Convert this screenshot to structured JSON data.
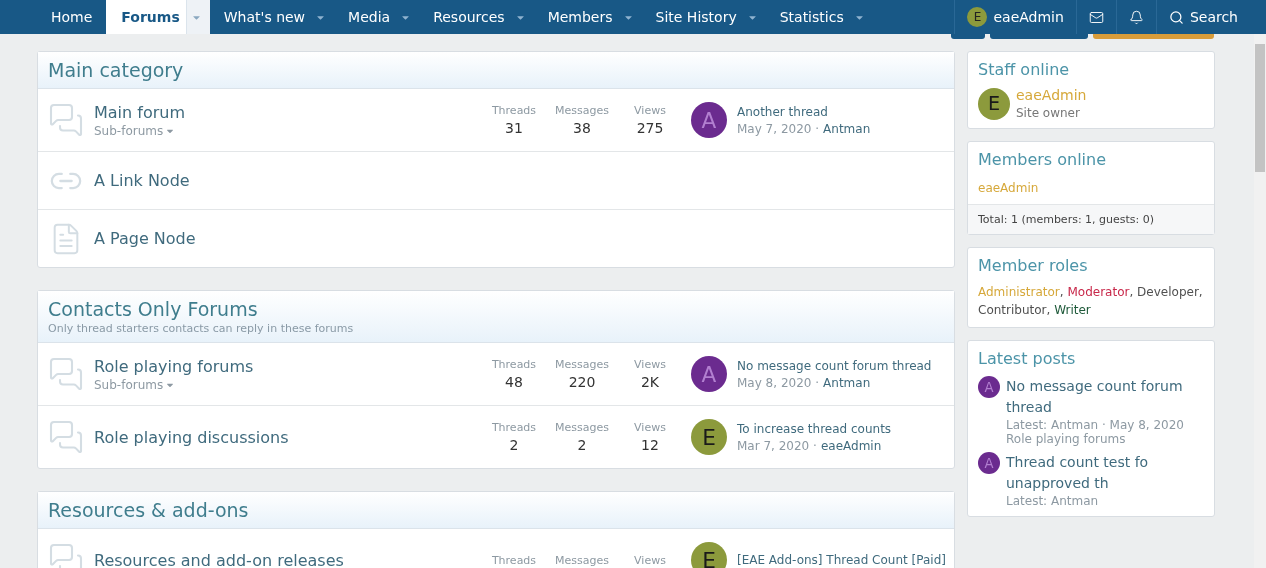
{
  "nav": {
    "tabs": [
      {
        "label": "Home",
        "selected": false,
        "dropdown": false
      },
      {
        "label": "Forums",
        "selected": true,
        "dropdown": true
      },
      {
        "label": "What's new",
        "selected": false,
        "dropdown": true
      },
      {
        "label": "Media",
        "selected": false,
        "dropdown": true
      },
      {
        "label": "Resources",
        "selected": false,
        "dropdown": true
      },
      {
        "label": "Members",
        "selected": false,
        "dropdown": true
      },
      {
        "label": "Site History",
        "selected": false,
        "dropdown": true
      },
      {
        "label": "Statistics",
        "selected": false,
        "dropdown": true
      }
    ],
    "user": {
      "letter": "E",
      "name": "eaeAdmin"
    },
    "search": "Search"
  },
  "categories": [
    {
      "title": "Main category",
      "nodes": [
        {
          "kind": "forum",
          "title": "Main forum",
          "subforums": "Sub-forums",
          "stats": [
            {
              "label": "Threads",
              "value": "31"
            },
            {
              "label": "Messages",
              "value": "38"
            },
            {
              "label": "Views",
              "value": "275"
            }
          ],
          "last": {
            "letter": "A",
            "color": "#6b2b8f",
            "title": "Another thread",
            "date": "May 7, 2020 ·",
            "user": "Antman"
          }
        },
        {
          "kind": "link",
          "title": "A Link Node"
        },
        {
          "kind": "page",
          "title": "A Page Node"
        }
      ]
    },
    {
      "title": "Contacts Only Forums",
      "description": "Only thread starters contacts can reply in these forums",
      "nodes": [
        {
          "kind": "forum",
          "title": "Role playing forums",
          "subforums": "Sub-forums",
          "stats": [
            {
              "label": "Threads",
              "value": "48"
            },
            {
              "label": "Messages",
              "value": "220"
            },
            {
              "label": "Views",
              "value": "2K"
            }
          ],
          "last": {
            "letter": "A",
            "color": "#6b2b8f",
            "title": "No message count forum thread",
            "date": "May 8, 2020 ·",
            "user": "Antman"
          }
        },
        {
          "kind": "forum",
          "title": "Role playing discussions",
          "stats": [
            {
              "label": "Threads",
              "value": "2"
            },
            {
              "label": "Messages",
              "value": "2"
            },
            {
              "label": "Views",
              "value": "12"
            }
          ],
          "last": {
            "letter": "E",
            "color": "#8c9a3c",
            "title": "To increase thread counts",
            "date": "Mar 7, 2020 ·",
            "user": "eaeAdmin"
          }
        }
      ]
    },
    {
      "title": "Resources & add-ons",
      "nodes": [
        {
          "kind": "forum",
          "title": "Resources and add-on releases",
          "stats": [
            {
              "label": "Threads"
            },
            {
              "label": "Messages"
            },
            {
              "label": "Views"
            }
          ],
          "last": {
            "letter": "E",
            "color": "#8c9a3c",
            "title": "[EAE Add-ons] Thread Count [Paid]"
          }
        }
      ]
    }
  ],
  "sidebar": {
    "staff": {
      "title": "Staff online",
      "members": [
        {
          "letter": "E",
          "name": "eaeAdmin",
          "role": "Site owner"
        }
      ]
    },
    "online": {
      "title": "Members online",
      "members": [
        "eaeAdmin"
      ],
      "total": "Total: 1 (members: 1, guests: 0)"
    },
    "roles": {
      "title": "Member roles",
      "items": [
        {
          "label": "Administrator",
          "color": "#d6a83a",
          "separator": ","
        },
        {
          "label": "Moderator",
          "color": "#c8284a",
          "separator": ","
        },
        {
          "label": "Developer",
          "color": "#505050",
          "separator": ","
        },
        {
          "label": "Contributor",
          "color": "#505050",
          "separator": ","
        },
        {
          "label": "Writer",
          "color": "#1f5a3a"
        }
      ]
    },
    "latest": {
      "title": "Latest posts",
      "posts": [
        {
          "letter": "A",
          "title": "No message count forum thread",
          "meta": "Latest: Antman · May 8, 2020",
          "forum": "Role playing forums"
        },
        {
          "letter": "A",
          "title": "Thread count test fo unapproved th",
          "meta": "Latest: Antman"
        }
      ]
    }
  }
}
